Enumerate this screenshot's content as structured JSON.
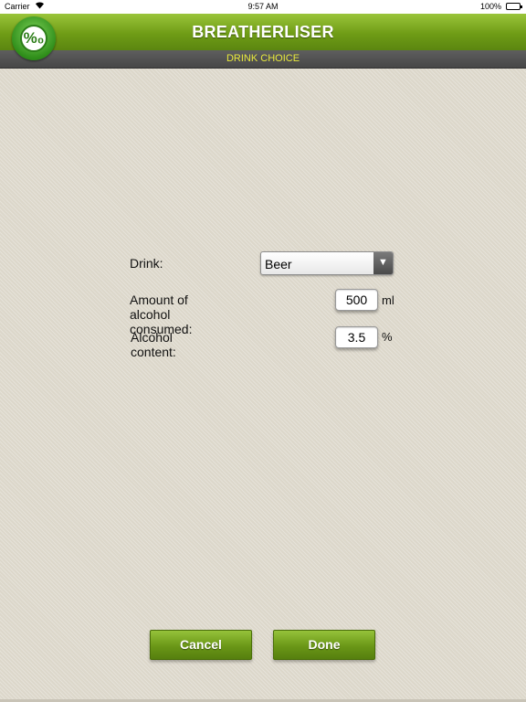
{
  "status_bar": {
    "carrier": "Carrier",
    "time": "9:57 AM",
    "battery": "100%"
  },
  "header": {
    "title": "BREATHERLISER",
    "subtitle": "DRINK CHOICE",
    "logo_text": "%₀"
  },
  "form": {
    "drink_label": "Drink:",
    "drink_value": "Beer",
    "amount_label": "Amount of alcohol consumed:",
    "amount_value": "500",
    "amount_unit": "ml",
    "content_label": "Alcohol content:",
    "content_value": "3.5",
    "content_unit": "%"
  },
  "buttons": {
    "cancel": "Cancel",
    "done": "Done"
  },
  "icons": {
    "wifi": "wifi-icon",
    "battery": "battery-icon",
    "dropdown": "triangle-down-icon",
    "logo": "permille-badge-icon"
  },
  "colors": {
    "header_green": "#6f9c16",
    "subtitle_yellow": "#e9ea3c",
    "subbar_gray": "#4f4f4f",
    "background": "#dcd7ca"
  }
}
